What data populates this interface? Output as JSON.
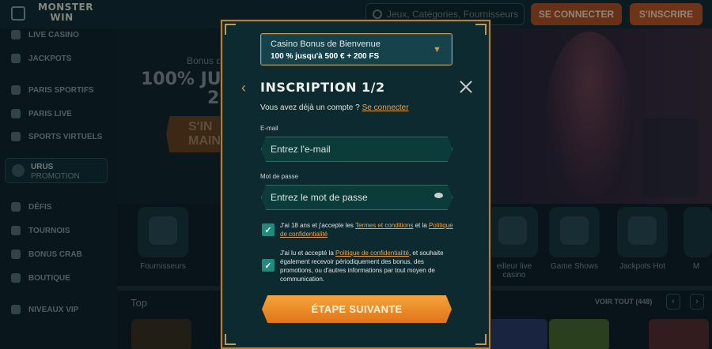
{
  "header": {
    "logo_text": "MONSTER WIN",
    "search_placeholder": "Jeux, Catégories, Fournisseurs",
    "login_button": "SE CONNECTER",
    "signup_button": "S'INSCRIRE"
  },
  "sidebar": {
    "items": [
      {
        "label": "LIVE CASINO",
        "icon": "live-casino-icon"
      },
      {
        "label": "JACKPOTS",
        "icon": "jackpots-icon"
      },
      {
        "label": "PARIS SPORTIFS",
        "icon": "sports-icon"
      },
      {
        "label": "PARIS LIVE",
        "icon": "live-bets-icon"
      },
      {
        "label": "SPORTS VIRTUELS",
        "icon": "virtual-sports-icon"
      },
      {
        "label": "DÉFIS",
        "icon": "challenges-icon"
      },
      {
        "label": "TOURNOIS",
        "icon": "trophy-icon"
      },
      {
        "label": "BONUS CRAB",
        "icon": "crab-icon"
      },
      {
        "label": "BOUTIQUE",
        "icon": "shop-icon"
      },
      {
        "label": "NIVEAUX VIP",
        "icon": "vip-icon"
      }
    ],
    "promo": {
      "title": "URUS",
      "subtitle": "PROMOTION"
    }
  },
  "hero": {
    "subtitle": "Bonus d",
    "line1": "100% JUSQ",
    "line2": "20",
    "button": "S'IN MAIN"
  },
  "categories": [
    {
      "label": "Fournisseurs"
    },
    {
      "label": "eilleur live casino"
    },
    {
      "label": "Game Shows"
    },
    {
      "label": "Jackpots Hot"
    },
    {
      "label": "M"
    }
  ],
  "games_row": {
    "title": "Top",
    "see_all": "VOIR TOUT (448)"
  },
  "modal": {
    "bonus_select": {
      "line1": "Casino Bonus de Bienvenue",
      "line2": "100 % jusqu'à 500 € + 200 FS"
    },
    "title": "INSCRIPTION 1/2",
    "have_account": "Vous avez déjà un compte ?",
    "login_link": "Se connecter",
    "email_label": "E-mail",
    "email_placeholder": "Entrez l'e-mail",
    "password_label": "Mot de passe",
    "password_placeholder": "Entrez le mot de passe",
    "checkbox1": {
      "prefix": "J'ai 18 ans et j'accepte les",
      "link1": "Termes et conditions",
      "middle": "et la",
      "link2": "Politique de confidentialité",
      "checked": true
    },
    "checkbox2": {
      "prefix": "J'ai lu et accepté la",
      "link": "Politique de confidentialité",
      "suffix": ", et souhaite également recevoir périodiquement des bonus, des promotions, ou d'autres informations par tout moyen de communication.",
      "checked": true
    },
    "next_button": "ÉTAPE SUIVANTE"
  },
  "colors": {
    "accent_orange": "#e0741a",
    "link_orange": "#e8a34e",
    "modal_bg": "#0e2a31",
    "gold_border": "#a9834a",
    "checkbox_teal": "#1f8a7d"
  }
}
